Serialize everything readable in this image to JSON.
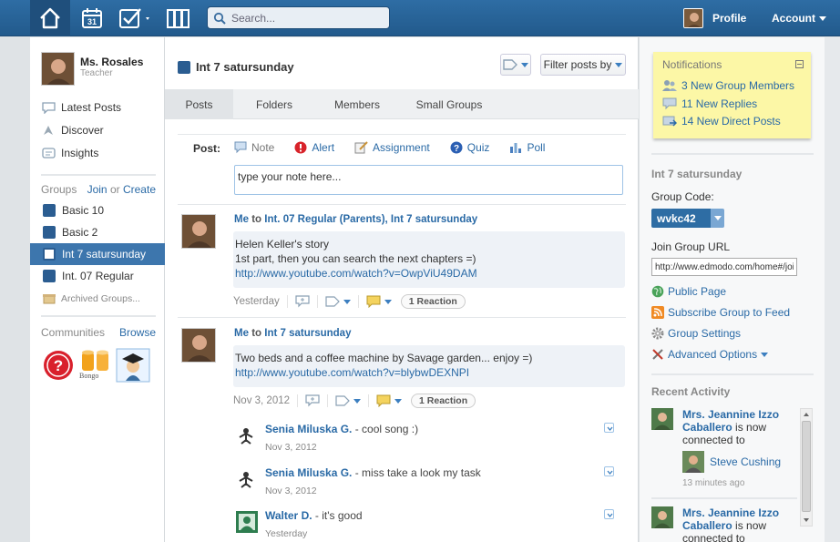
{
  "topbar": {
    "search_placeholder": "Search...",
    "calendar_day": "31",
    "profile_label": "Profile",
    "account_label": "Account"
  },
  "sidebar": {
    "user_name": "Ms. Rosales",
    "user_role": "Teacher",
    "nav": [
      {
        "label": "Latest Posts",
        "icon": "speech-bubble-icon"
      },
      {
        "label": "Discover",
        "icon": "compass-icon"
      },
      {
        "label": "Insights",
        "icon": "chart-bubble-icon"
      }
    ],
    "groups_title": "Groups",
    "join_label": "Join",
    "or_label": "or",
    "create_label": "Create",
    "groups": [
      {
        "label": "Basic 10",
        "active": false
      },
      {
        "label": "Basic 2",
        "active": false
      },
      {
        "label": "Int 7 satursunday",
        "active": true
      },
      {
        "label": "Int. 07 Regular",
        "active": false
      }
    ],
    "archived_label": "Archived Groups...",
    "communities_title": "Communities",
    "browse_label": "Browse",
    "bongo_label": "Bongo"
  },
  "main": {
    "group_title": "Int 7 satursunday",
    "filter_label": "Filter posts by",
    "tabs": [
      "Posts",
      "Folders",
      "Members",
      "Small Groups"
    ],
    "post_label": "Post:",
    "post_types": [
      "Note",
      "Alert",
      "Assignment",
      "Quiz",
      "Poll"
    ],
    "note_placeholder": "type your note here...",
    "posts": [
      {
        "from": "Me",
        "to_word": "to",
        "recipients": "Int. 07 Regular (Parents), Int 7 satursunday",
        "lines": [
          "Helen Keller's story",
          "1st part, then you can search the next chapters =)"
        ],
        "link": "http://www.youtube.com/watch?v=OwpViU49DAM",
        "date": "Yesterday",
        "reactions": "1 Reaction"
      },
      {
        "from": "Me",
        "to_word": "to",
        "recipients": "Int 7 satursunday",
        "lines": [
          "Two beds and a coffee machine by Savage garden... enjoy =)"
        ],
        "link": "http://www.youtube.com/watch?v=blybwDEXNPI",
        "date": "Nov 3, 2012",
        "reactions": "1 Reaction"
      }
    ],
    "replies": [
      {
        "who": "Senia Miluska G.",
        "text": " - cool song :)",
        "date": "Nov 3, 2012"
      },
      {
        "who": "Senia Miluska G.",
        "text": " - miss take a look my task",
        "date": "Nov 3, 2012"
      },
      {
        "who": "Walter D.",
        "text": " - it's good",
        "date": "Yesterday"
      }
    ]
  },
  "right": {
    "notifications_title": "Notifications",
    "notifications": [
      {
        "label": "3 New Group Members",
        "icon": "group-members-icon"
      },
      {
        "label": "11 New Replies",
        "icon": "reply-bubble-icon"
      },
      {
        "label": "14 New Direct Posts",
        "icon": "direct-post-icon"
      }
    ],
    "group_name": "Int 7 satursunday",
    "group_code_label": "Group Code:",
    "group_code": "wvkc42",
    "join_url_label": "Join Group URL",
    "join_url": "http://www.edmodo.com/home#/join",
    "links": [
      {
        "label": "Public Page",
        "icon": "globe-icon"
      },
      {
        "label": "Subscribe Group to Feed",
        "icon": "rss-icon"
      },
      {
        "label": "Group Settings",
        "icon": "gear-icon"
      },
      {
        "label": "Advanced Options",
        "icon": "tools-icon"
      }
    ],
    "recent_title": "Recent Activity",
    "activities": [
      {
        "name": "Mrs. Jeannine Izzo Caballero",
        "text": " is now connected to",
        "target": "Steve Cushing",
        "ago": "13 minutes ago"
      },
      {
        "name": "Mrs. Jeannine Izzo Caballero",
        "text": " is now connected to"
      }
    ]
  },
  "colors": {
    "topbar": "#2e6da4",
    "link": "#2a6aa6",
    "group_square": "#2b5d91",
    "notification_bg": "#fcf7a6"
  }
}
